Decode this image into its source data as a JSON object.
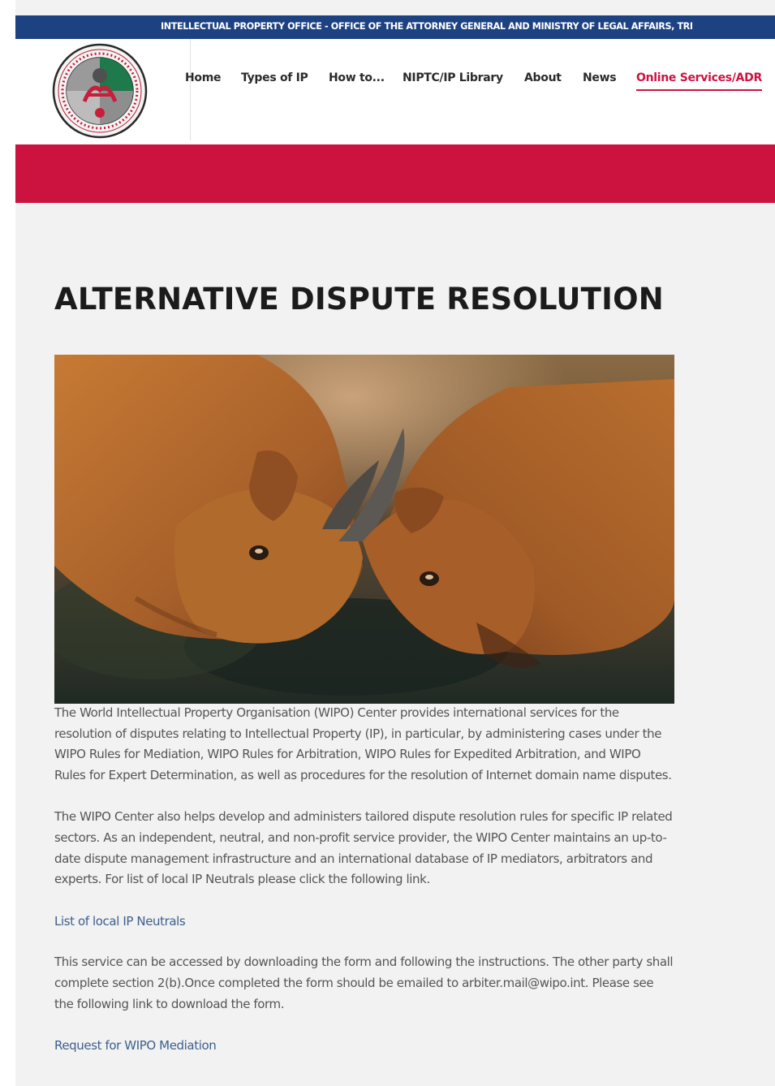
{
  "topbar": {
    "text": "INTELLECTUAL PROPERTY OFFICE - OFFICE OF THE ATTORNEY GENERAL AND MINISTRY OF LEGAL AFFAIRS, TRI"
  },
  "logo": {
    "icon": "seal-logo-icon",
    "ring_text": "OFFICE OF THE ATTORNEY GENERAL AND MINISTRY OF LEGAL AFFAIRS · INTELLECTUAL PROPERTY OFFICE"
  },
  "nav": {
    "items": [
      {
        "label": "Home"
      },
      {
        "label": "Types of IP"
      },
      {
        "label": "How to..."
      },
      {
        "label": "NIPTC/IP Library"
      },
      {
        "label": "About"
      },
      {
        "label": "News"
      },
      {
        "label": "Online Services/ADR",
        "active": true
      }
    ]
  },
  "colors": {
    "topbar": "#1d4282",
    "accent": "#cc1340",
    "background": "#f2f2f2",
    "link": "#3d5f8c"
  },
  "page": {
    "title": "ALTERNATIVE DISPUTE RESOLUTION"
  },
  "hero": {
    "icon": "goats-headbutting-photo"
  },
  "content": {
    "p1": "The World Intellectual Property Organisation (WIPO) Center provides international services for the resolution of disputes relating to Intellectual Property (IP), in particular, by administering cases under the WIPO Rules for Mediation, WIPO Rules for Arbitration, WIPO Rules for Expedited Arbitration, and WIPO Rules for Expert Determination, as well as procedures for the resolution of Internet domain name disputes.",
    "p2": "The WIPO Center also helps develop and administers tailored dispute resolution rules for specific IP related sectors. As an independent, neutral, and non-profit service provider, the WIPO Center maintains an up-to-date dispute management infrastructure and an international database of IP mediators, arbitrators and experts. For list of local IP Neutrals please click the following link.",
    "link1": "List of local IP Neutrals",
    "p3": "This service can be accessed by downloading the form and following the instructions. The other party shall complete section 2(b).Once completed the form should be emailed to arbiter.mail@wipo.int. Please see the following link to download the form.",
    "link2": "Request for WIPO Mediation"
  }
}
